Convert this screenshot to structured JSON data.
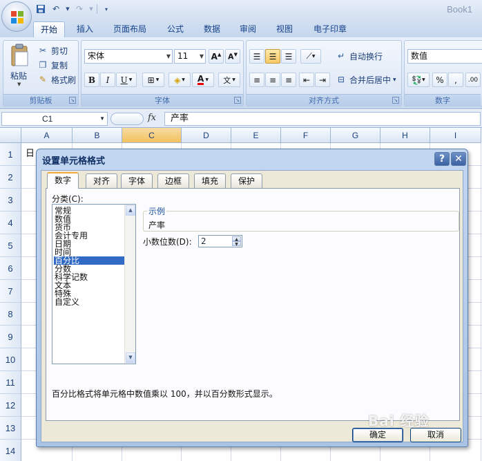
{
  "window": {
    "title": "Book1"
  },
  "ribbon": {
    "tabs": [
      "开始",
      "插入",
      "页面布局",
      "公式",
      "数据",
      "审阅",
      "视图",
      "电子印章"
    ],
    "clipboard": {
      "label": "剪贴板",
      "paste": "粘贴",
      "cut": "剪切",
      "copy": "复制",
      "format_painter": "格式刷"
    },
    "font": {
      "label": "字体",
      "name": "宋体",
      "size": "11"
    },
    "alignment": {
      "label": "对齐方式",
      "wrap_text": "自动换行",
      "merge_center": "合并后居中"
    },
    "number": {
      "label": "数字",
      "format": "数值"
    }
  },
  "formula_bar": {
    "name_box": "C1",
    "fx": "fx",
    "content": "产率"
  },
  "sheet": {
    "columns": [
      "A",
      "B",
      "C",
      "D",
      "E",
      "F",
      "G",
      "H",
      "I"
    ],
    "rows": [
      "1",
      "2",
      "3",
      "4",
      "5",
      "6",
      "7",
      "8",
      "9",
      "10",
      "11",
      "12",
      "13",
      "14"
    ],
    "a1_text": "日"
  },
  "dialog": {
    "title": "设置单元格格式",
    "tabs": [
      "数字",
      "对齐",
      "字体",
      "边框",
      "填充",
      "保护"
    ],
    "category_label": "分类(C):",
    "categories": [
      "常规",
      "数值",
      "货币",
      "会计专用",
      "日期",
      "时间",
      "百分比",
      "分数",
      "科学记数",
      "文本",
      "特殊",
      "自定义"
    ],
    "selected_category": "百分比",
    "sample_label": "示例",
    "sample_value": "产率",
    "decimal_label": "小数位数(D):",
    "decimal_value": "2",
    "description": "百分比格式将单元格中数值乘以 100，并以百分数形式显示。",
    "ok": "确定",
    "cancel": "取消"
  },
  "watermark": "Bai 经验",
  "colors": {
    "accent": "#316ac5",
    "ribbon": "#dbe6f5",
    "dialog_frame": "#a9c3e6"
  }
}
